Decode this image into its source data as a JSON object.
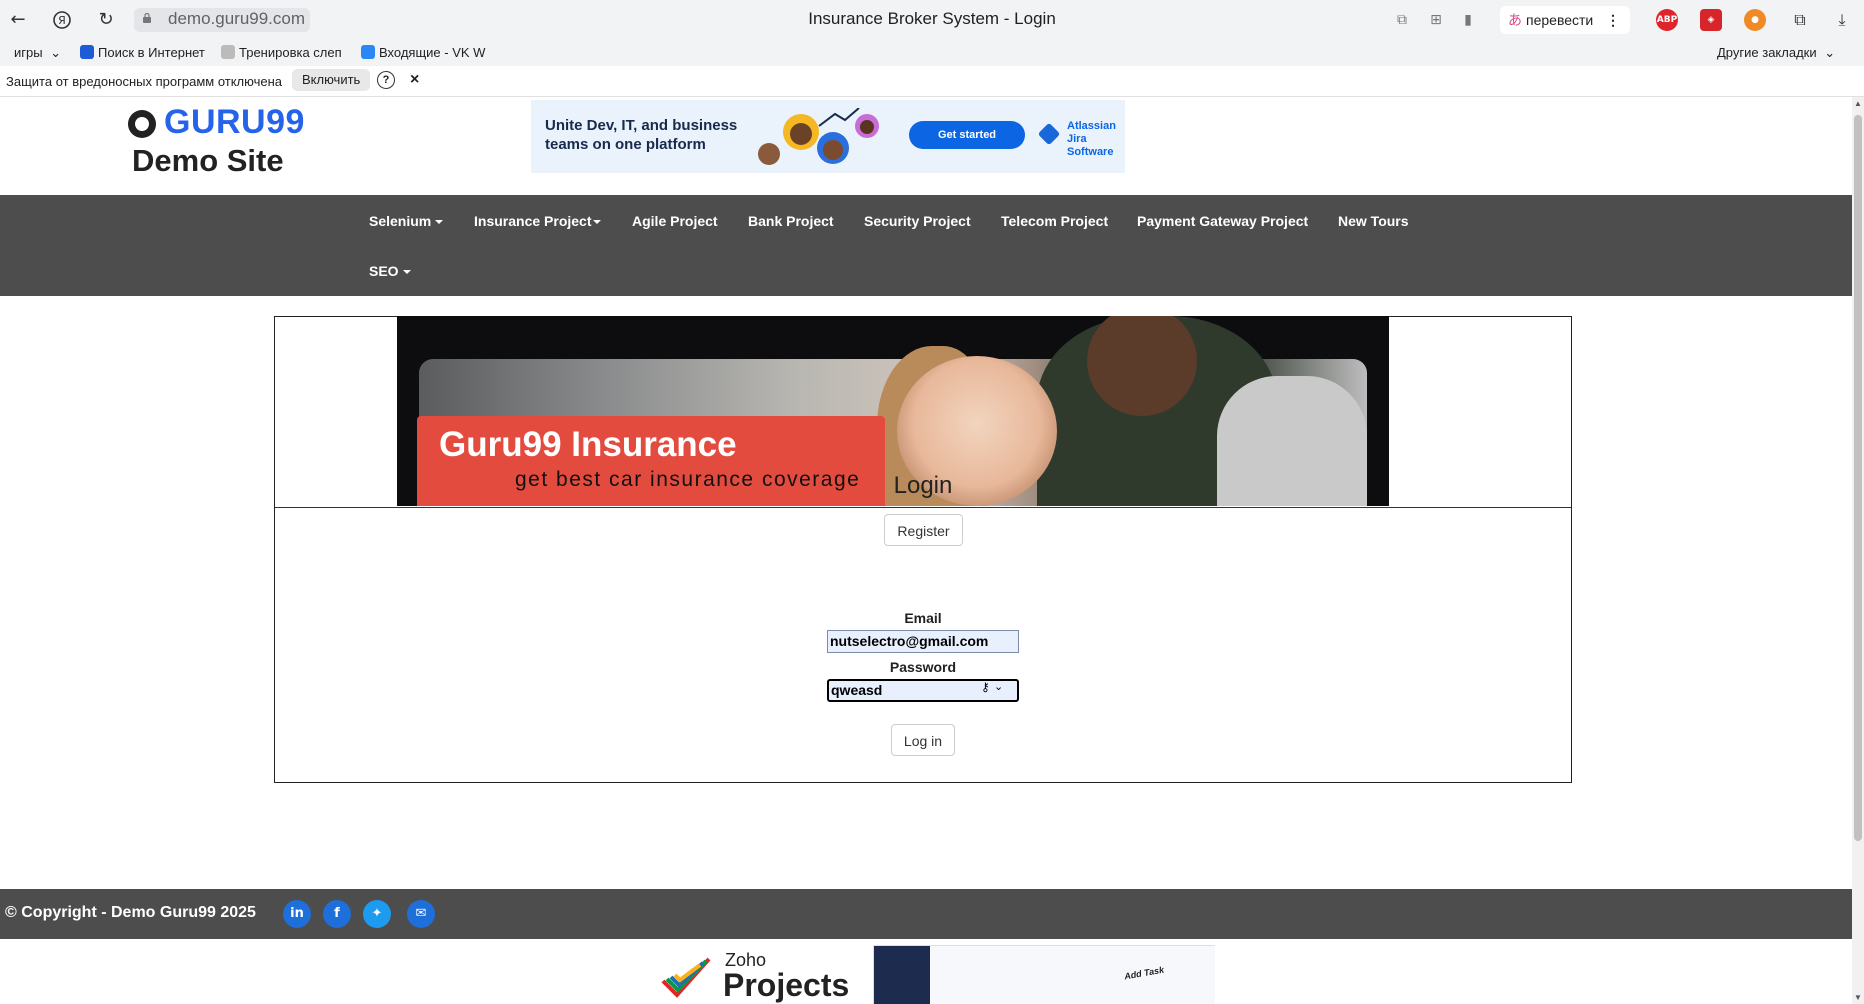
{
  "browser": {
    "url": "demo.guru99.com",
    "window_title": "Insurance Broker System - Login",
    "translate_label": "перевести",
    "extensions": [
      "ABP"
    ],
    "bookmarks": [
      {
        "label": "игры",
        "icon": "folder-icon"
      },
      {
        "label": "Поиск в Интернет",
        "icon": "search-icon"
      },
      {
        "label": "Тренировка слеп",
        "icon": "page-icon"
      },
      {
        "label": "Входящие - VK W",
        "icon": "mail-icon"
      }
    ],
    "other_bookmarks": "Другие закладки",
    "infobar": {
      "message": "Защита от вредоносных программ отключена",
      "enable_button": "Включить",
      "help": "?",
      "close": "×"
    }
  },
  "site": {
    "logo_brand": "GURU99",
    "logo_subtitle": "Demo Site",
    "ad": {
      "headline": "Unite Dev, IT, and business teams on one platform",
      "cta": "Get started",
      "brand_line1": "Atlassian",
      "brand_line2": "Jira Software"
    },
    "nav": [
      {
        "label": "Selenium",
        "dropdown": true
      },
      {
        "label": "Insurance Project",
        "dropdown": true
      },
      {
        "label": "Agile Project",
        "dropdown": false
      },
      {
        "label": "Bank Project",
        "dropdown": false
      },
      {
        "label": "Security Project",
        "dropdown": false
      },
      {
        "label": "Telecom Project",
        "dropdown": false
      },
      {
        "label": "Payment Gateway Project",
        "dropdown": false
      },
      {
        "label": "New Tours",
        "dropdown": false
      },
      {
        "label": "SEO",
        "dropdown": true
      }
    ]
  },
  "hero": {
    "title": "Guru99 Insurance",
    "subtitle": "get best car insurance coverage"
  },
  "login": {
    "register_button": "Register",
    "title": "Login",
    "email_label": "Email",
    "email_value": "nutselectro@gmail.com",
    "password_label": "Password",
    "password_value": "qweasd",
    "login_button": "Log in"
  },
  "footer": {
    "copyright": "© Copyright - Demo Guru99 2025",
    "social": [
      "linkedin-icon",
      "facebook-icon",
      "twitter-icon",
      "email-icon"
    ]
  },
  "bottom_ad": {
    "brand_small": "Zoho",
    "brand_large": "Projects",
    "annotation": "Add Task"
  },
  "colors": {
    "nav_bg": "#4d4d4d",
    "brand_blue": "#2563eb",
    "hero_red": "#e44b3f",
    "autofill_bg": "#e8f0fe"
  }
}
